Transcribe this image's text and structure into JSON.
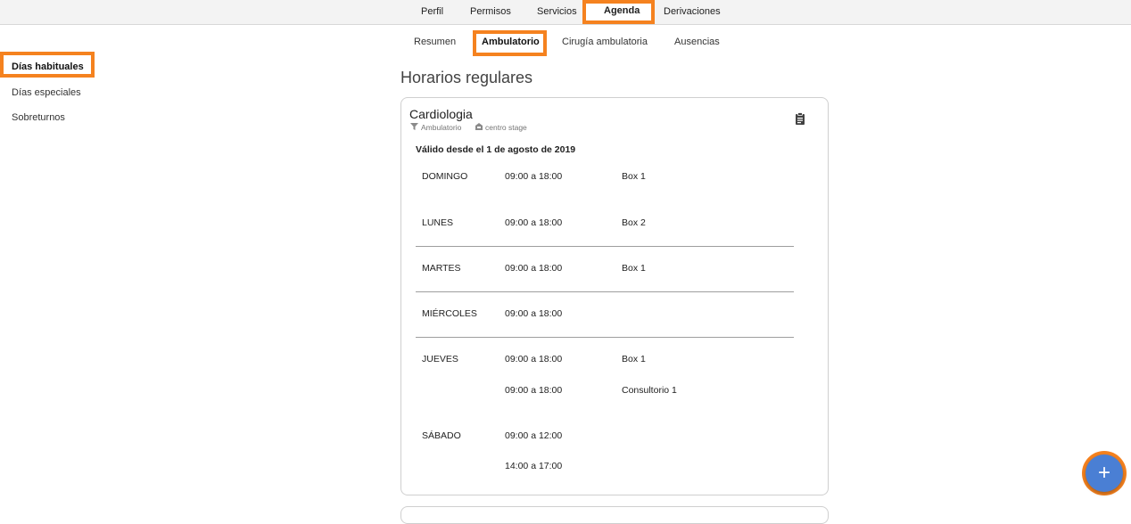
{
  "top_tabs": [
    {
      "label": "Perfil"
    },
    {
      "label": "Permisos"
    },
    {
      "label": "Servicios"
    },
    {
      "label": "Agenda"
    },
    {
      "label": "Derivaciones"
    }
  ],
  "sub_tabs": [
    {
      "label": "Resumen"
    },
    {
      "label": "Ambulatorio"
    },
    {
      "label": "Cirugía ambulatoria"
    },
    {
      "label": "Ausencias"
    }
  ],
  "sidebar": {
    "items": [
      {
        "label": "Días habituales"
      },
      {
        "label": "Días especiales"
      },
      {
        "label": "Sobreturnos"
      }
    ]
  },
  "main": {
    "title": "Horarios regulares",
    "card": {
      "title": "Cardiologia",
      "type_label": "Ambulatorio",
      "center_label": "centro stage",
      "valid_from": "Válido desde el 1 de agosto de 2019",
      "schedule": [
        {
          "day": "DOMINGO",
          "time": "09:00 a 18:00",
          "room": "Box 1"
        },
        {
          "day": "LUNES",
          "time": "09:00 a 18:00",
          "room": "Box 2"
        },
        {
          "day": "MARTES",
          "time": "09:00 a 18:00",
          "room": "Box 1"
        },
        {
          "day": "MIÉRCOLES",
          "time": "09:00 a 18:00",
          "room": ""
        },
        {
          "day": "JUEVES",
          "time": "09:00 a 18:00",
          "room": "Box 1"
        },
        {
          "day": "",
          "time": "09:00 a 18:00",
          "room": "Consultorio 1"
        },
        {
          "day": "SÁBADO",
          "time": "09:00 a 12:00",
          "room": ""
        },
        {
          "day": "",
          "time": "14:00 a 17:00",
          "room": ""
        }
      ]
    }
  },
  "fab": {
    "label": "+"
  },
  "colors": {
    "highlight": "#f5821f",
    "fab": "#4a7fd4",
    "topbar": "#f3f3f3"
  },
  "icons": [
    "filter-icon",
    "building-icon",
    "clipboard-icon",
    "plus-icon"
  ]
}
